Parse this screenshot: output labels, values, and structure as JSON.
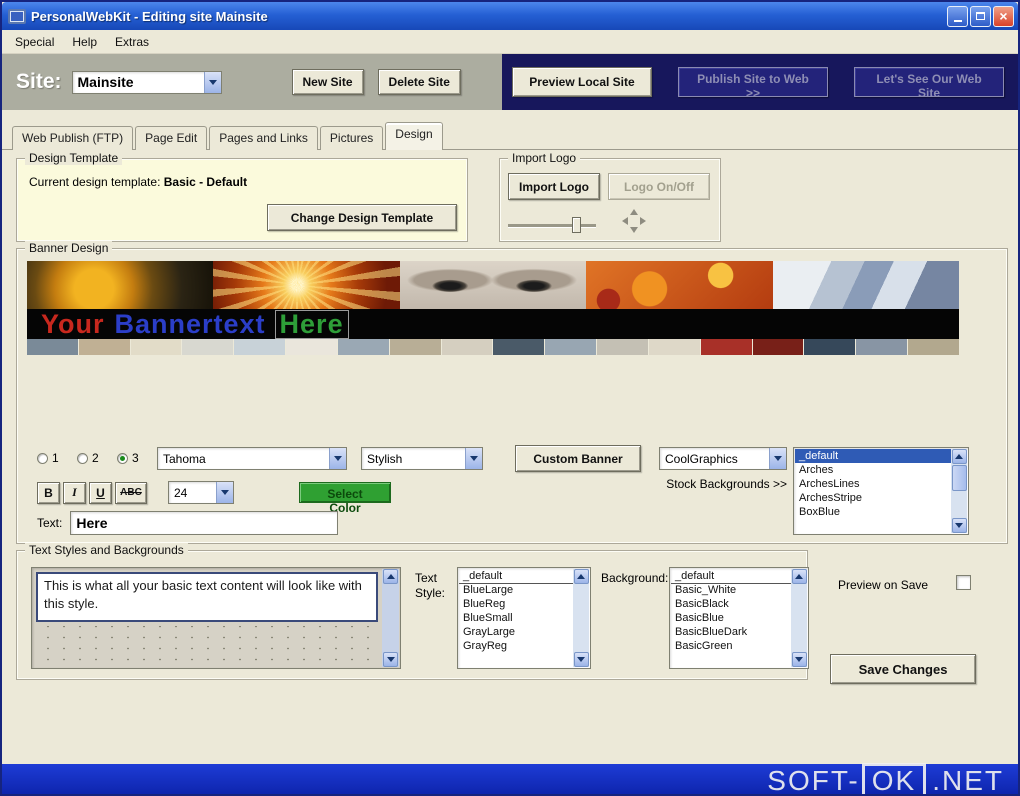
{
  "window": {
    "title": "PersonalWebKit - Editing site Mainsite"
  },
  "menu": {
    "items": [
      "Special",
      "Help",
      "Extras"
    ]
  },
  "site_bar": {
    "label": "Site:",
    "site_name": "Mainsite",
    "new_site_button": "New Site",
    "delete_site_button": "Delete Site",
    "preview_local_button": "Preview Local Site",
    "publish_button": "Publish Site to Web >>",
    "view_web_button": "Let's See Our Web Site"
  },
  "tabs": {
    "items": [
      {
        "label": "Web Publish (FTP)"
      },
      {
        "label": "Page Edit"
      },
      {
        "label": "Pages and Links"
      },
      {
        "label": "Pictures"
      },
      {
        "label": "Design",
        "active": true
      }
    ]
  },
  "design_template": {
    "group_label": "Design Template",
    "current_label": "Current design template:",
    "current_value": "Basic - Default",
    "change_button": "Change Design Template"
  },
  "import_logo": {
    "group_label": "Import Logo",
    "import_button": "Import Logo",
    "toggle_button": "Logo On/Off"
  },
  "banner_design": {
    "group_label": "Banner Design",
    "images": [
      "sunflower",
      "light-burst",
      "eyes",
      "oranges",
      "architecture"
    ],
    "banner_text": {
      "part1": "Your",
      "part1_color": "#C8281E",
      "part2": "Bannertext",
      "part2_color": "#2B3EC8",
      "part3": "Here",
      "part3_color": "#2E9E38"
    },
    "swatches": [
      {
        "color": "#7A8A98"
      },
      {
        "color": "#C0B094"
      },
      {
        "color": "#E2DCC8"
      },
      {
        "color": "#D8D8D0"
      },
      {
        "color": "#C8D2D8"
      },
      {
        "color": "#EAE6DC"
      },
      {
        "color": "#9AA8B4"
      },
      {
        "color": "#B8AE96"
      },
      {
        "color": "#D5CFC0"
      },
      {
        "color": "#4A5A68"
      },
      {
        "color": "#98A6B2"
      },
      {
        "color": "#C4C0B4"
      },
      {
        "color": "#DED8C8"
      },
      {
        "color": "#A83028"
      },
      {
        "color": "#782018"
      },
      {
        "color": "#36485A"
      },
      {
        "color": "#8895A4"
      },
      {
        "color": "#B2A88E"
      }
    ],
    "layout_radios": [
      {
        "label": "1",
        "checked": false
      },
      {
        "label": "2",
        "checked": false
      },
      {
        "label": "3",
        "checked": true
      }
    ],
    "font_select": "Tahoma",
    "style_select": "Stylish",
    "custom_banner_button": "Custom Banner",
    "graphics_select": "CoolGraphics",
    "stock_backgrounds_label": "Stock Backgrounds >>",
    "background_list": [
      {
        "label": "_default",
        "selected": true
      },
      {
        "label": "Arches"
      },
      {
        "label": "ArchesLines"
      },
      {
        "label": "ArchesStripe"
      },
      {
        "label": "BoxBlue"
      }
    ],
    "bold_button": "B",
    "italic_button": "I",
    "underline_button": "U",
    "strike_button": "ABC",
    "size_select": "24",
    "select_color_button": "Select Color",
    "select_color_bg": "#2FA032",
    "text_label": "Text:",
    "text_value": "Here"
  },
  "text_styles": {
    "group_label": "Text Styles and Backgrounds",
    "preview_text": "This is what all your basic text content will look like with this style.",
    "text_style_label": "Text Style:",
    "text_style_list": [
      {
        "label": "_default",
        "selected": true
      },
      {
        "label": "BlueLarge"
      },
      {
        "label": "BlueReg"
      },
      {
        "label": "BlueSmall"
      },
      {
        "label": "GrayLarge"
      },
      {
        "label": "GrayReg"
      }
    ],
    "background_label": "Background:",
    "background_list": [
      {
        "label": "_default",
        "selected": true
      },
      {
        "label": "Basic_White"
      },
      {
        "label": "BasicBlack"
      },
      {
        "label": "BasicBlue"
      },
      {
        "label": "BasicBlueDark"
      },
      {
        "label": "BasicGreen"
      }
    ]
  },
  "right_panel": {
    "preview_on_save_label": "Preview on Save",
    "save_button": "Save Changes"
  },
  "watermark": {
    "part1": "SOFT-",
    "part2": "OK",
    "part3": ".NET"
  }
}
